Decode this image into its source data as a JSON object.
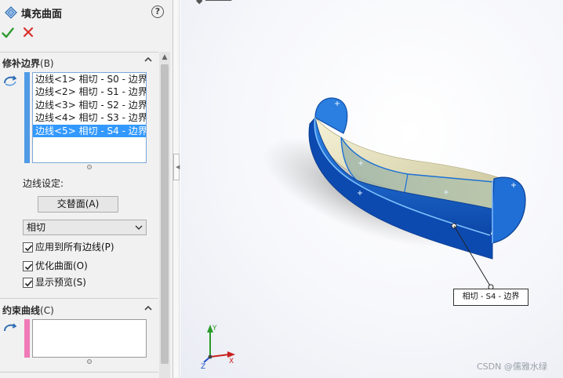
{
  "feature": {
    "title": "填充曲面"
  },
  "patch_boundary": {
    "label": "修补边界",
    "shortcut": "(B)",
    "edges": [
      "边线<1> 相切 - S0 - 边界",
      "边线<2> 相切 - S1 - 边界",
      "边线<3> 相切 - S2 - 边界",
      "边线<4> 相切 - S3 - 边界",
      "边线<5> 相切 - S4 - 边界"
    ],
    "selected_index": 4,
    "edge_settings_label": "边线设定:",
    "alternate_face_label": "交替面(A)",
    "condition_value": "相切",
    "apply_all_label": "应用到所有边线(P)",
    "apply_all_checked": true,
    "optimize_label": "优化曲面(O)",
    "optimize_checked": true,
    "preview_label": "显示预览(S)",
    "preview_checked": true,
    "strip_color": "#4f9be6"
  },
  "constraint_curves": {
    "label": "约束曲线",
    "shortcut": "(C)",
    "strip_color": "#ef7ab7"
  },
  "viewport": {
    "callout_text": "相切 - S4 - 边界",
    "axis_labels": [
      "Y",
      "X",
      "Z"
    ],
    "watermark": "CSDN @儒雅水绿",
    "accent_color": "#1a6fd4"
  }
}
